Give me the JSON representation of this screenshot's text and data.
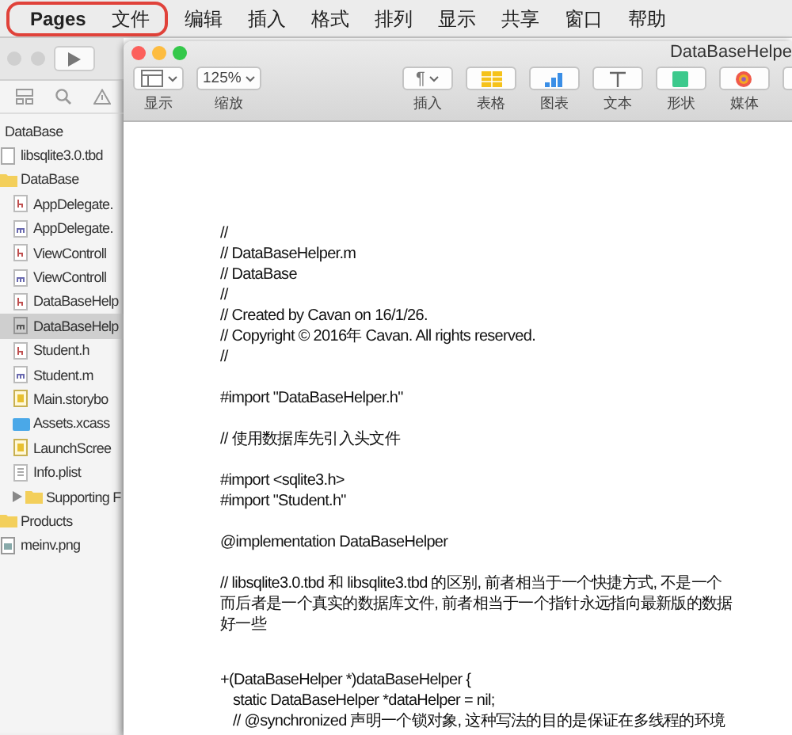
{
  "menubar": {
    "items": [
      {
        "label": "Pages",
        "kind": "app",
        "circled": true
      },
      {
        "label": "文件",
        "kind": "menu",
        "circled": true
      },
      {
        "label": "编辑",
        "kind": "menu",
        "circled": false
      },
      {
        "label": "插入",
        "kind": "menu",
        "circled": false
      },
      {
        "label": "格式",
        "kind": "menu",
        "circled": false
      },
      {
        "label": "排列",
        "kind": "menu",
        "circled": false
      },
      {
        "label": "显示",
        "kind": "menu",
        "circled": false
      },
      {
        "label": "共享",
        "kind": "menu",
        "circled": false
      },
      {
        "label": "窗口",
        "kind": "menu",
        "circled": false
      },
      {
        "label": "帮助",
        "kind": "menu",
        "circled": false
      }
    ]
  },
  "navigator": {
    "tree": [
      {
        "label": "DataBase",
        "kind": "project",
        "selected": false,
        "children": [
          {
            "label": "libsqlite3.0.tbd",
            "kind": "library",
            "selected": false
          },
          {
            "label": "DataBase",
            "kind": "folder",
            "selected": false,
            "children": [
              {
                "label": "AppDelegate.",
                "kind": "header",
                "selected": false
              },
              {
                "label": "AppDelegate.",
                "kind": "source",
                "selected": false
              },
              {
                "label": "ViewControll",
                "kind": "header",
                "selected": false
              },
              {
                "label": "ViewControll",
                "kind": "source",
                "selected": false
              },
              {
                "label": "DataBaseHelp",
                "kind": "header",
                "selected": false
              },
              {
                "label": "DataBaseHelp",
                "kind": "source",
                "selected": true
              },
              {
                "label": "Student.h",
                "kind": "header",
                "selected": false
              },
              {
                "label": "Student.m",
                "kind": "source",
                "selected": false
              },
              {
                "label": "Main.storybo",
                "kind": "storyboard",
                "selected": false
              },
              {
                "label": "Assets.xcass",
                "kind": "assets",
                "selected": false
              },
              {
                "label": "LaunchScree",
                "kind": "storyboard",
                "selected": false
              },
              {
                "label": "Info.plist",
                "kind": "plist",
                "selected": false
              },
              {
                "label": "Supporting F",
                "kind": "folder",
                "selected": false,
                "expanded": false
              }
            ]
          },
          {
            "label": "Products",
            "kind": "folder",
            "selected": false
          },
          {
            "label": "meinv.png",
            "kind": "image",
            "selected": false
          }
        ]
      }
    ]
  },
  "pages_window": {
    "title": "DataBaseHelpe",
    "toolbar": [
      {
        "kind": "view",
        "caption": "显示"
      },
      {
        "kind": "zoom",
        "value": "125%",
        "caption": "缩放"
      },
      {
        "kind": "insert",
        "glyph": "¶",
        "caption": "插入"
      },
      {
        "kind": "table",
        "caption": "表格"
      },
      {
        "kind": "chart",
        "caption": "图表"
      },
      {
        "kind": "text",
        "caption": "文本"
      },
      {
        "kind": "shape",
        "caption": "形状"
      },
      {
        "kind": "media",
        "caption": "媒体"
      },
      {
        "kind": "more"
      }
    ]
  },
  "document": {
    "blocks": [
      {
        "kind": "section",
        "lines": [
          {
            "text": "//",
            "indented": false
          },
          {
            "text": "//  DataBaseHelper.m",
            "indented": false
          },
          {
            "text": "//  DataBase",
            "indented": false
          },
          {
            "text": "//",
            "indented": false
          },
          {
            "text": "//  Created by Cavan on 16/1/26.",
            "indented": false
          },
          {
            "text": "//  Copyright © 2016年 Cavan. All rights reserved.",
            "indented": false
          },
          {
            "text": "//",
            "indented": false
          }
        ]
      },
      {
        "kind": "section",
        "lines": [
          {
            "text": "#import \"DataBaseHelper.h\"",
            "indented": false
          }
        ]
      },
      {
        "kind": "section",
        "lines": [
          {
            "text": "// 使用数据库先引入头文件",
            "indented": false
          }
        ]
      },
      {
        "kind": "section",
        "lines": [
          {
            "text": "#import <sqlite3.h>",
            "indented": false
          },
          {
            "text": "#import \"Student.h\"",
            "indented": false
          }
        ]
      },
      {
        "kind": "section",
        "lines": [
          {
            "text": "@implementation DataBaseHelper",
            "indented": false
          }
        ]
      },
      {
        "kind": "section",
        "lines": [
          {
            "text": "// libsqlite3.0.tbd 和 libsqlite3.tbd 的区别, 前者相当于一个快捷方式, 不是一个",
            "indented": false
          },
          {
            "text": "而后者是一个真实的数据库文件, 前者相当于一个指针永远指向最新版的数据",
            "indented": false
          },
          {
            "text": "好一些",
            "indented": false
          }
        ]
      },
      {
        "kind": "method",
        "lines": [
          {
            "text": "+(DataBaseHelper *)dataBaseHelper {",
            "indented": false
          },
          {
            "text": "static DataBaseHelper *dataHelper = nil;",
            "indented": true
          },
          {
            "text": "// @synchronized 声明一个锁对象, 这种写法的目的是保证在多线程的环境",
            "indented": true
          }
        ]
      }
    ]
  }
}
